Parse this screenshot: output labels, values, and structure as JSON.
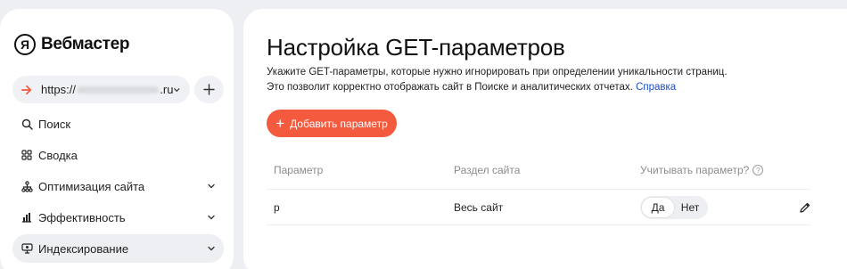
{
  "app": {
    "logo_letter": "Я",
    "name": "Вебмастер"
  },
  "site_selector": {
    "prefix": "https://",
    "suffix": ".ru"
  },
  "sidebar": {
    "items": [
      {
        "label": "Поиск",
        "icon": "search-icon"
      },
      {
        "label": "Сводка",
        "icon": "grid-icon"
      },
      {
        "label": "Оптимизация сайта",
        "icon": "sitemap-icon"
      },
      {
        "label": "Эффективность",
        "icon": "bar-chart-icon"
      },
      {
        "label": "Индексирование",
        "icon": "indexing-icon"
      }
    ]
  },
  "page": {
    "title": "Настройка GET-параметров",
    "desc_line1": "Укажите GET-параметры, которые нужно игнорировать при определении уникальности страниц.",
    "desc_line2": "Это позволит корректно отображать сайт в Поиске и аналитических отчетах.",
    "help_link": "Справка",
    "add_button": "Добавить параметр"
  },
  "table": {
    "headers": {
      "param": "Параметр",
      "section": "Раздел сайта",
      "consider": "Учитывать параметр?"
    },
    "rows": [
      {
        "param": "p",
        "section": "Весь сайт",
        "yes": "Да",
        "no": "Нет"
      }
    ]
  },
  "colors": {
    "accent": "#f35a3e",
    "link": "#1a4ec4"
  }
}
